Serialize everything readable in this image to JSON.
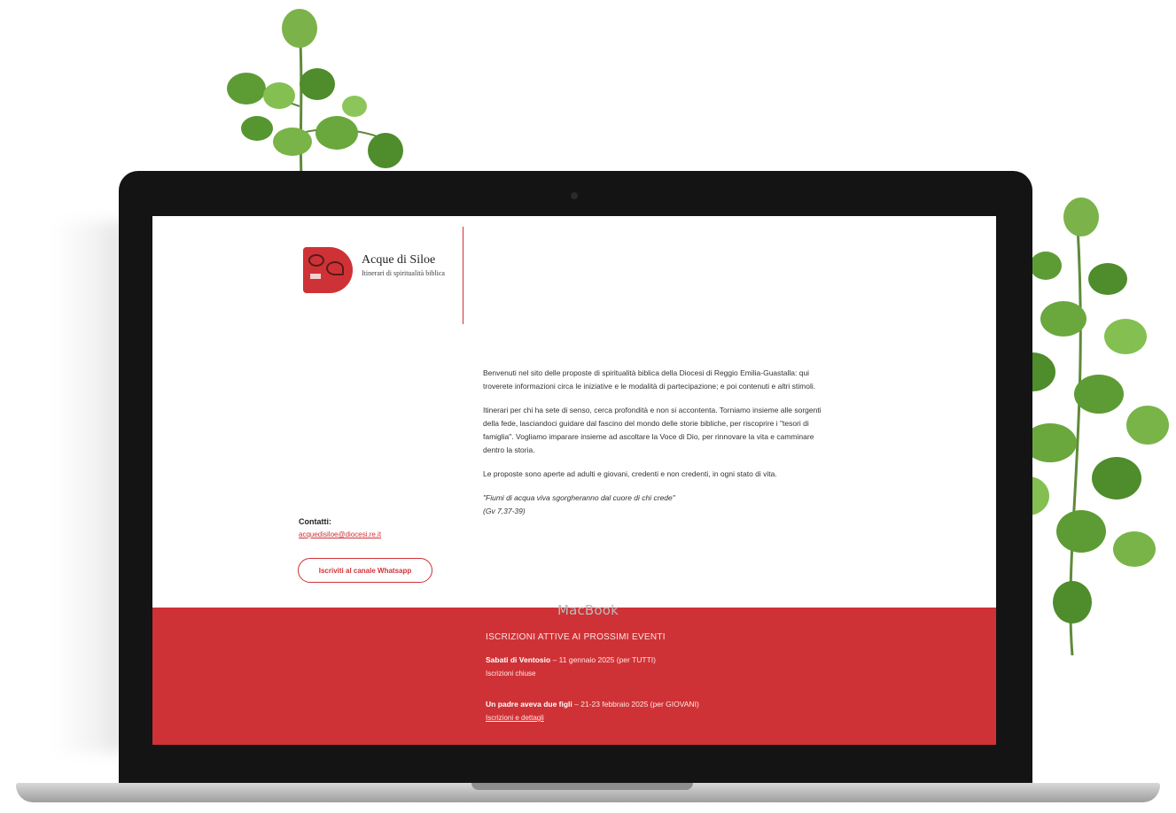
{
  "device": {
    "label": "MacBook"
  },
  "site": {
    "brand_title": "Acque di Siloe",
    "brand_subtitle": "Itinerari di spiritualità biblica",
    "intro_paragraphs": [
      "Benvenuti nel sito delle proposte di spiritualità biblica della Diocesi di Reggio Emilia-Guastalla: qui troverete informazioni circa le iniziative e le modalità di partecipazione; e poi contenuti e altri stimoli.",
      "Itinerari per chi ha sete di senso, cerca profondità e non si accontenta. Torniamo insieme alle sorgenti della fede, lasciandoci guidare dal fascino del mondo delle storie bibliche, per riscoprire i \"tesori di famiglia\". Vogliamo imparare insieme ad ascoltare la Voce di Dio, per rinnovare la vita e camminare dentro la storia.",
      "Le proposte sono aperte ad adulti e giovani, credenti e non credenti, in ogni stato di vita."
    ],
    "quote": "\"Fiumi di acqua viva sgorgheranno dal cuore di chi crede\"",
    "quote_ref": "(Gv 7,37-39)",
    "contacts_label": "Contatti:",
    "contacts_email": "acquedisiloe@diocesi.re.it",
    "whatsapp_button": "Iscriviti al canale Whatsapp",
    "events_title": "ISCRIZIONI ATTIVE AI PROSSIMI EVENTI",
    "events": [
      {
        "name": "Sabati di Ventosio",
        "detail": " – 11 gennaio 2025 (per TUTTI)",
        "status": "Iscrizioni chiuse"
      },
      {
        "name": "Un padre aveva due figli",
        "detail": " – 21-23 febbraio 2025 (per GIOVANI)",
        "status": "Iscrizioni e dettagli"
      }
    ]
  },
  "colors": {
    "brand_red": "#cf3236",
    "bezel": "#141414"
  }
}
